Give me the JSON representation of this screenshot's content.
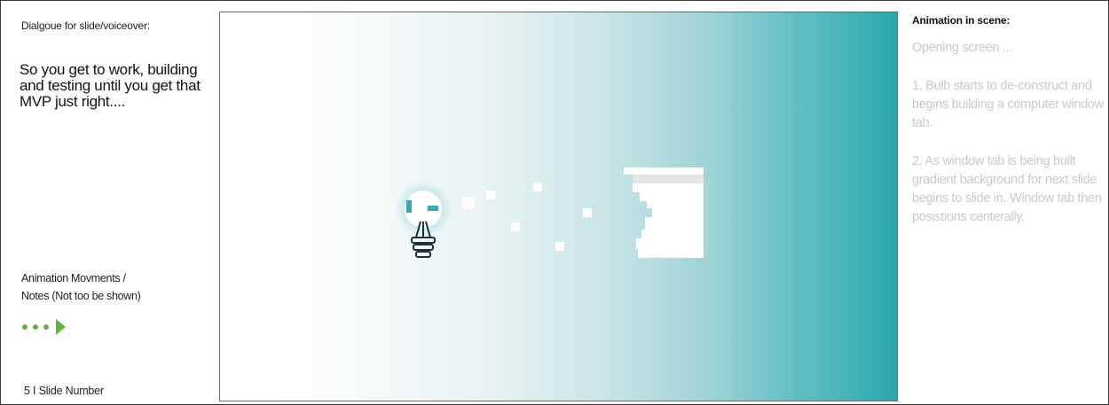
{
  "dialogue": {
    "heading": "Dialgoue for slide/voiceover:",
    "text": "So you get to work, building and testing until you get that MVP just right...."
  },
  "notes": {
    "line1": "Animation Movments /",
    "line2": "Notes (Not too be shown)"
  },
  "footer": {
    "slide_number_label": "5  I  Slide Number"
  },
  "animation": {
    "heading": "Animation in scene:",
    "notes": [
      "Opening screen ...",
      "1. Bulb starts to de-construct and begins building a computer window tab.",
      "2. As window tab is being built gradient background for next slide begins to slide in. Window tab then posistions centerally."
    ]
  },
  "icons": {
    "nav": "play-dots-icon",
    "bulb": "lightbulb-icon",
    "window": "window-tab-icon"
  },
  "colors": {
    "accent_green": "#5fb43e",
    "teal": "#2aa8ae",
    "note_gray": "#c9c9c9"
  }
}
